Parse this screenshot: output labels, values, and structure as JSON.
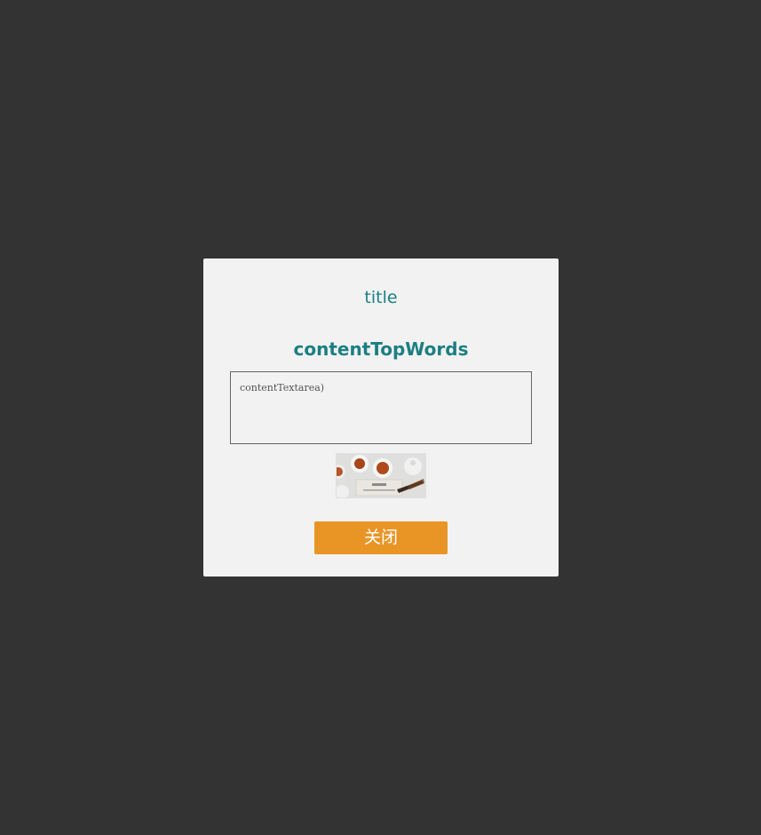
{
  "dialog": {
    "title": "title",
    "content_top_words": "contentTopWords",
    "textarea_value": "contentTextarea)",
    "close_label": "关闭"
  },
  "thumbnail": {
    "icon": "tea-cups-image"
  },
  "colors": {
    "backdrop": "#333333",
    "panel": "#f2f2f2",
    "heading": "#1c7f82",
    "button": "#e89525",
    "button_text": "#ffffff"
  }
}
